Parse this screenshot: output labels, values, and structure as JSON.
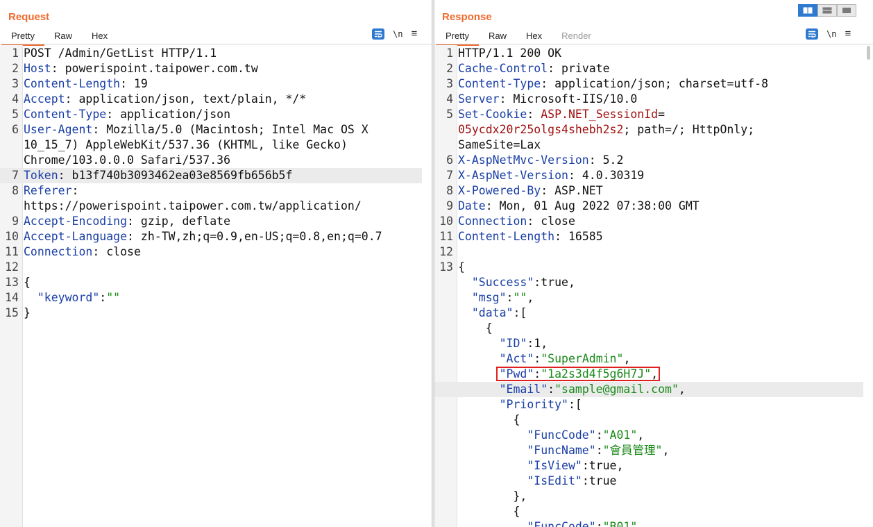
{
  "layout_toggle": {
    "icons": [
      "split-columns-icon",
      "split-rows-icon",
      "single-pane-icon"
    ],
    "active": 0
  },
  "request": {
    "title": "Request",
    "tabs": [
      "Pretty",
      "Raw",
      "Hex"
    ],
    "tools": {
      "newline_label": "\\n",
      "menu_label": "≡"
    },
    "lines": [
      {
        "n": "1",
        "k": "",
        "sep": "",
        "v": "POST /Admin/GetList HTTP/1.1"
      },
      {
        "n": "2",
        "k": "Host",
        "sep": ": ",
        "v": "powerispoint.taipower.com.tw"
      },
      {
        "n": "3",
        "k": "Content-Length",
        "sep": ": ",
        "v": "19"
      },
      {
        "n": "4",
        "k": "Accept",
        "sep": ": ",
        "v": "application/json, text/plain, */*"
      },
      {
        "n": "5",
        "k": "Content-Type",
        "sep": ": ",
        "v": "application/json"
      },
      {
        "n": "6",
        "k": "User-Agent",
        "sep": ": ",
        "v": "Mozilla/5.0 (Macintosh; Intel Mac OS X"
      },
      {
        "n": "",
        "k": "",
        "sep": "",
        "v": "10_15_7) AppleWebKit/537.36 (KHTML, like Gecko)"
      },
      {
        "n": "",
        "k": "",
        "sep": "",
        "v": "Chrome/103.0.0.0 Safari/537.36"
      },
      {
        "n": "7",
        "k": "Token",
        "sep": ": ",
        "v": "b13f740b3093462ea03e8569fb656b5f"
      },
      {
        "n": "8",
        "k": "Referer",
        "sep": ":",
        "v": ""
      },
      {
        "n": "",
        "k": "",
        "sep": "",
        "v": "https://powerispoint.taipower.com.tw/application/"
      },
      {
        "n": "9",
        "k": "Accept-Encoding",
        "sep": ": ",
        "v": "gzip, deflate"
      },
      {
        "n": "10",
        "k": "Accept-Language",
        "sep": ": ",
        "v": "zh-TW,zh;q=0.9,en-US;q=0.8,en;q=0.7"
      },
      {
        "n": "11",
        "k": "Connection",
        "sep": ": ",
        "v": "close"
      },
      {
        "n": "12",
        "k": "",
        "sep": "",
        "v": ""
      },
      {
        "n": "13",
        "k": "",
        "sep": "",
        "v": "{"
      },
      {
        "n": "14",
        "k": "  \"keyword\"",
        "sep": ":",
        "v": "",
        "s": "\"\""
      },
      {
        "n": "15",
        "k": "",
        "sep": "",
        "v": "}"
      }
    ],
    "highlight_line": 8
  },
  "response": {
    "title": "Response",
    "tabs": [
      "Pretty",
      "Raw",
      "Hex",
      "Render"
    ],
    "tools": {
      "newline_label": "\\n",
      "menu_label": "≡"
    },
    "lines": [
      {
        "n": "1",
        "k": "",
        "sep": "",
        "v": "HTTP/1.1 200 OK"
      },
      {
        "n": "2",
        "k": "Cache-Control",
        "sep": ": ",
        "v": "private"
      },
      {
        "n": "3",
        "k": "Content-Type",
        "sep": ": ",
        "v": "application/json; charset=utf-8"
      },
      {
        "n": "4",
        "k": "Server",
        "sep": ": ",
        "v": "Microsoft-IIS/10.0"
      },
      {
        "n": "5",
        "k": "Set-Cookie",
        "sep": ": ",
        "v": "",
        "c": "ASP.NET_SessionId",
        "c2": "="
      },
      {
        "n": "",
        "k": "",
        "sep": "",
        "v": "; path=/; HttpOnly;",
        "cpre": "05ycdx20r25olgs4shebh2s2"
      },
      {
        "n": "",
        "k": "",
        "sep": "",
        "v": "SameSite=Lax"
      },
      {
        "n": "6",
        "k": "X-AspNetMvc-Version",
        "sep": ": ",
        "v": "5.2"
      },
      {
        "n": "7",
        "k": "X-AspNet-Version",
        "sep": ": ",
        "v": "4.0.30319"
      },
      {
        "n": "8",
        "k": "X-Powered-By",
        "sep": ": ",
        "v": "ASP.NET"
      },
      {
        "n": "9",
        "k": "Date",
        "sep": ": ",
        "v": "Mon, 01 Aug 2022 07:38:00 GMT"
      },
      {
        "n": "10",
        "k": "Connection",
        "sep": ": ",
        "v": "close"
      },
      {
        "n": "11",
        "k": "Content-Length",
        "sep": ": ",
        "v": "16585"
      },
      {
        "n": "12",
        "k": "",
        "sep": "",
        "v": ""
      },
      {
        "n": "13",
        "k": "",
        "sep": "",
        "v": "{"
      },
      {
        "n": "",
        "k": "  \"Success\"",
        "sep": ":",
        "v": "true,"
      },
      {
        "n": "",
        "k": "  \"msg\"",
        "sep": ":",
        "v": ",",
        "s": "\"\""
      },
      {
        "n": "",
        "k": "  \"data\"",
        "sep": ":",
        "v": "["
      },
      {
        "n": "",
        "k": "",
        "sep": "",
        "v": "    {"
      },
      {
        "n": "",
        "k": "      \"ID\"",
        "sep": ":",
        "v": "1,"
      },
      {
        "n": "",
        "k": "      \"Act\"",
        "sep": ":",
        "v": ",",
        "s": "\"SuperAdmin\""
      },
      {
        "n": "",
        "k": "      \"Pwd\"",
        "sep": ":",
        "v": ",",
        "s": "\"1a2s3d4f5g6H7J\""
      },
      {
        "n": "",
        "k": "      \"Email\"",
        "sep": ":",
        "v": ",",
        "s": "\"sample@gmail.com\""
      },
      {
        "n": "",
        "k": "      \"Priority\"",
        "sep": ":",
        "v": "["
      },
      {
        "n": "",
        "k": "",
        "sep": "",
        "v": "        {"
      },
      {
        "n": "",
        "k": "          \"FuncCode\"",
        "sep": ":",
        "v": ",",
        "s": "\"A01\""
      },
      {
        "n": "",
        "k": "          \"FuncName\"",
        "sep": ":",
        "v": ",",
        "s": "\"會員管理\""
      },
      {
        "n": "",
        "k": "          \"IsView\"",
        "sep": ":",
        "v": "true,"
      },
      {
        "n": "",
        "k": "          \"IsEdit\"",
        "sep": ":",
        "v": "true"
      },
      {
        "n": "",
        "k": "",
        "sep": "",
        "v": "        },"
      },
      {
        "n": "",
        "k": "",
        "sep": "",
        "v": "        {"
      },
      {
        "n": "",
        "k": "          \"FuncCode\"",
        "sep": ":",
        "v": "",
        "s": "\"B01\""
      }
    ],
    "highlight_line": 22,
    "boxed_line": 21
  }
}
